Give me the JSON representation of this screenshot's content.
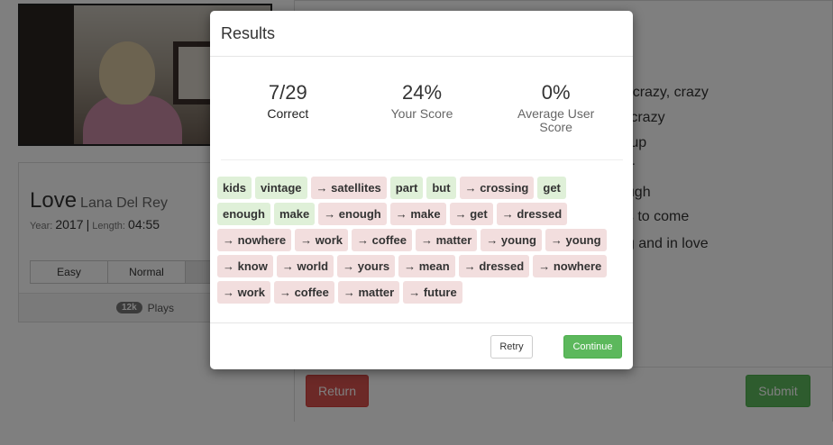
{
  "song": {
    "title": "Love",
    "artist": "Lana Del Rey",
    "year_label": "Year:",
    "year": "2017",
    "separator": "|",
    "length_label": "Length:",
    "length": "04:55",
    "difficulties": [
      "Easy",
      "Normal",
      ""
    ],
    "plays_count": "12k",
    "plays_label": "Plays"
  },
  "lyrics": {
    "visible_lines": [
      "y, crazy, crazy",
      "o crazy",
      "d up",
      "lar",
      "ough",
      "gs to come",
      "ng and in love"
    ]
  },
  "actions": {
    "return_label": "Return",
    "submit_label": "Submit"
  },
  "modal": {
    "title": "Results",
    "stats": [
      {
        "value": "7/29",
        "label": "Correct"
      },
      {
        "value": "24%",
        "label": "Your Score"
      },
      {
        "value": "0%",
        "label": "Average User Score"
      }
    ],
    "words": [
      {
        "text": "kids",
        "correct": true
      },
      {
        "text": "vintage",
        "correct": true
      },
      {
        "text": "→ satellites",
        "correct": false
      },
      {
        "text": "part",
        "correct": true
      },
      {
        "text": "but",
        "correct": true
      },
      {
        "text": "→ crossing",
        "correct": false
      },
      {
        "text": "get",
        "correct": true
      },
      {
        "text": "enough",
        "correct": true
      },
      {
        "text": "make",
        "correct": true
      },
      {
        "text": "→ enough",
        "correct": false
      },
      {
        "text": "→ make",
        "correct": false
      },
      {
        "text": "→ get",
        "correct": false
      },
      {
        "text": "→ dressed",
        "correct": false
      },
      {
        "text": "→ nowhere",
        "correct": false
      },
      {
        "text": "→ work",
        "correct": false
      },
      {
        "text": "→ coffee",
        "correct": false
      },
      {
        "text": "→ matter",
        "correct": false
      },
      {
        "text": "→ young",
        "correct": false
      },
      {
        "text": "→ young",
        "correct": false
      },
      {
        "text": "→ know",
        "correct": false
      },
      {
        "text": "→ world",
        "correct": false
      },
      {
        "text": "→ yours",
        "correct": false
      },
      {
        "text": "→ mean",
        "correct": false
      },
      {
        "text": "→ dressed",
        "correct": false
      },
      {
        "text": "→ nowhere",
        "correct": false
      },
      {
        "text": "→ work",
        "correct": false
      },
      {
        "text": "→ coffee",
        "correct": false
      },
      {
        "text": "→ matter",
        "correct": false
      },
      {
        "text": "→ future",
        "correct": false
      }
    ],
    "retry_label": "Retry",
    "continue_label": "Continue"
  }
}
